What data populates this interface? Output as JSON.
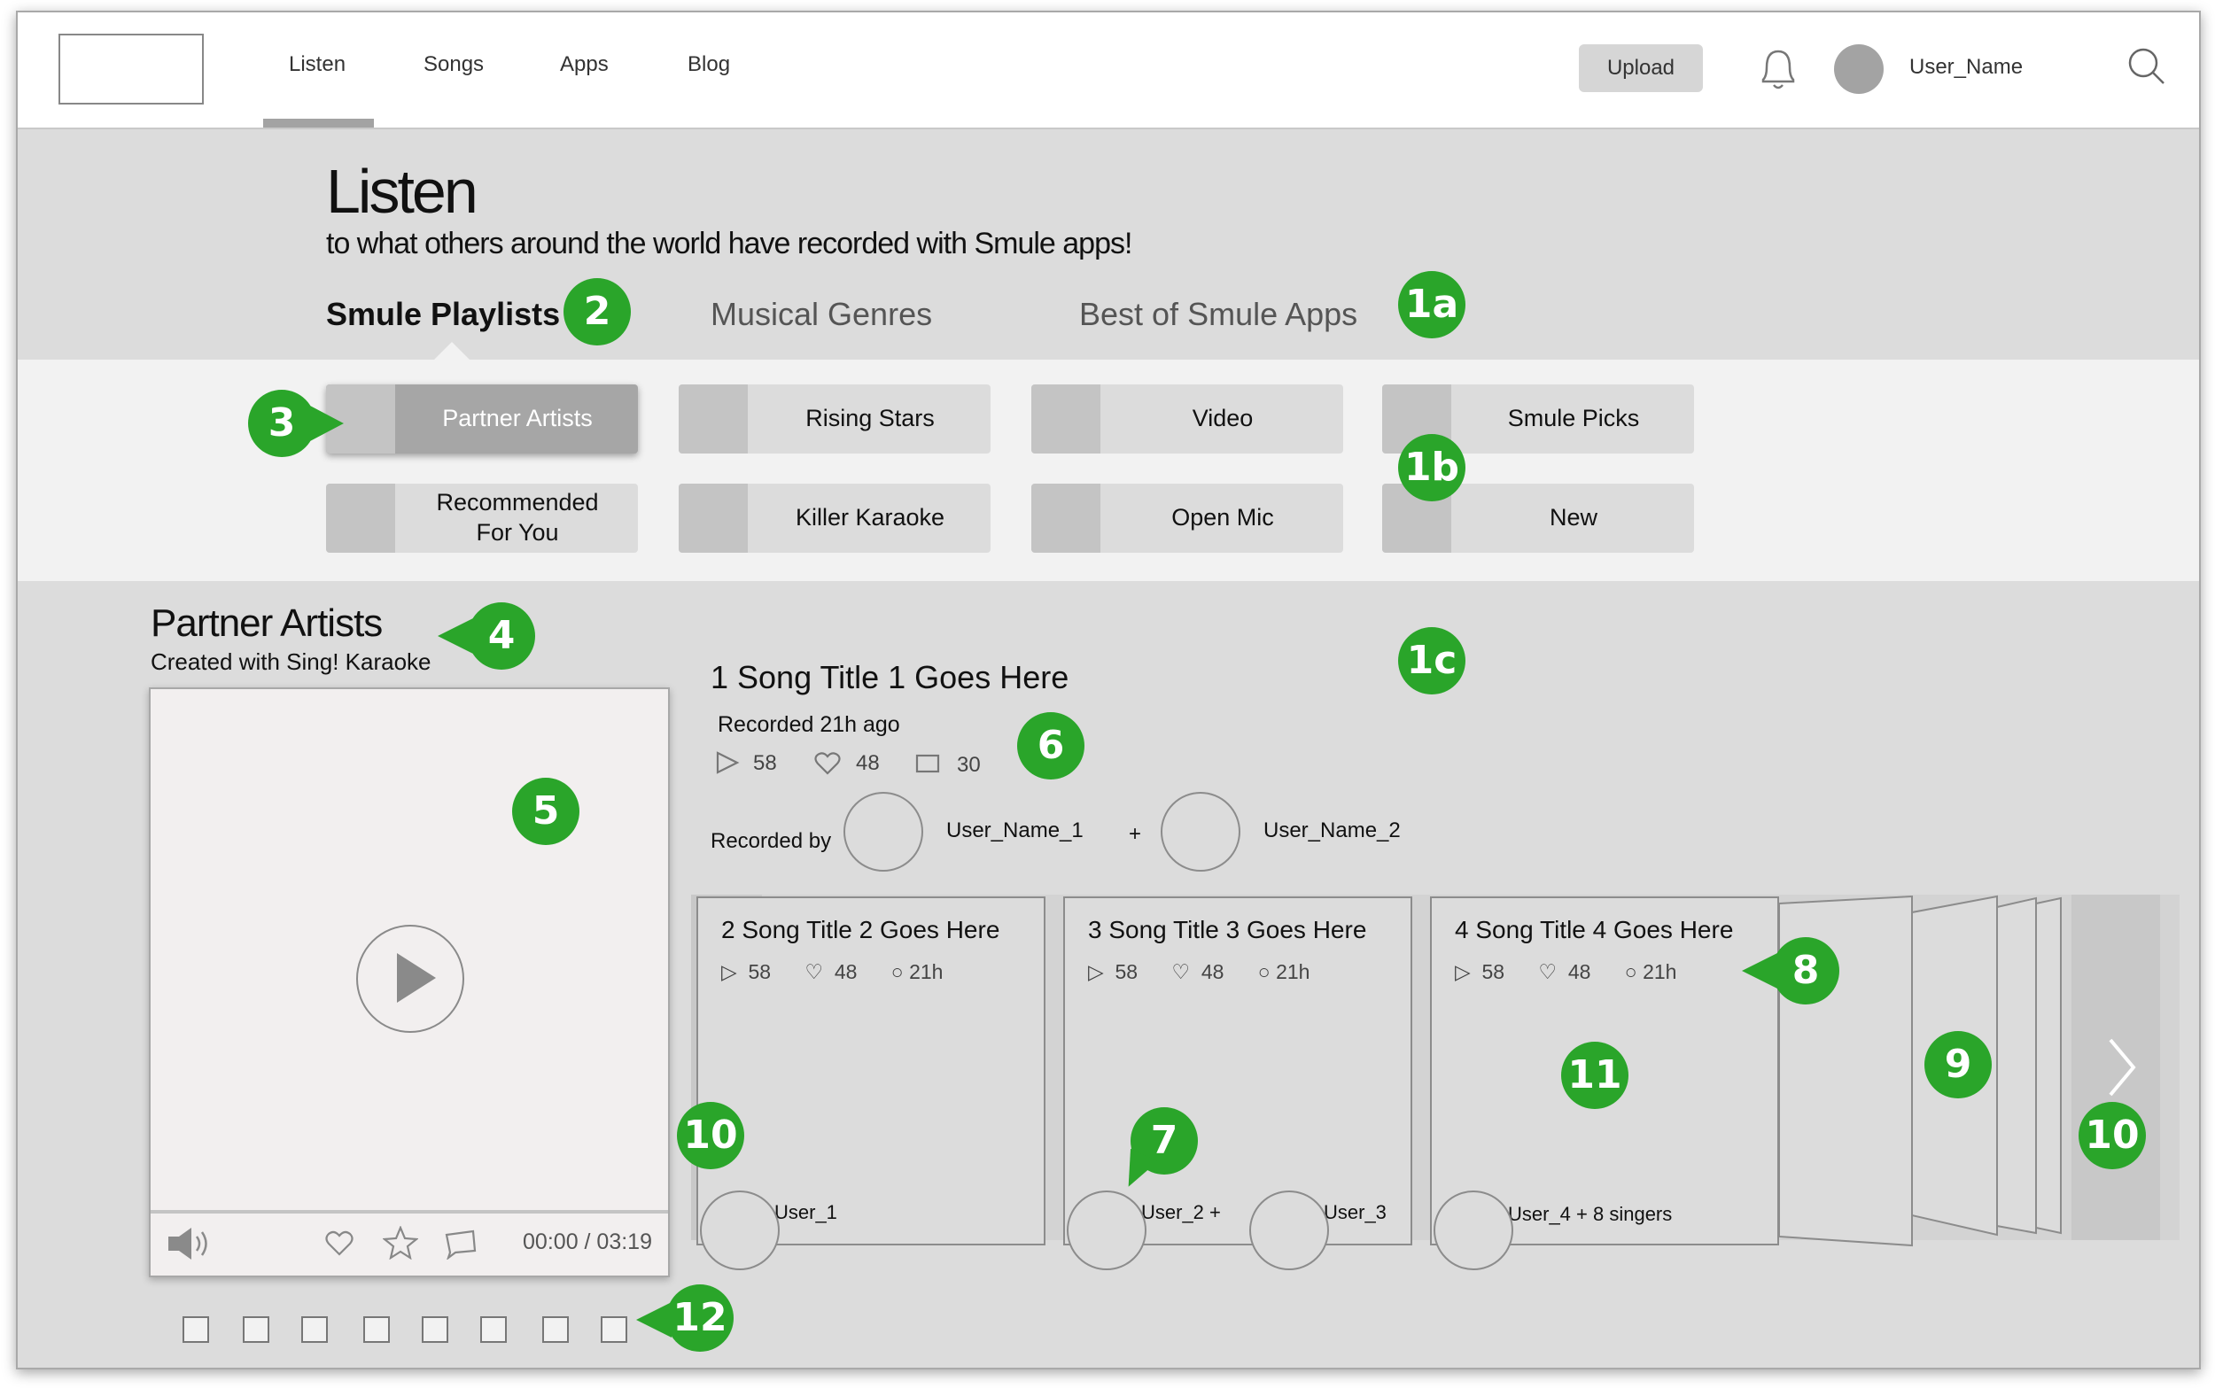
{
  "nav": {
    "items": [
      "Listen",
      "Songs",
      "Apps",
      "Blog"
    ],
    "upload_label": "Upload",
    "username": "User_Name"
  },
  "hero": {
    "title": "Listen",
    "subtitle": "to what others around the world have recorded with Smule apps!"
  },
  "tabs": [
    "Smule Playlists",
    "Musical Genres",
    "Best of Smule Apps"
  ],
  "categories": [
    "Partner Artists",
    "Rising Stars",
    "Video",
    "Smule Picks",
    "Recommended For You",
    "Killer Karaoke",
    "Open Mic",
    "New"
  ],
  "section": {
    "title": "Partner Artists",
    "subtitle": "Created with Sing! Karaoke"
  },
  "player": {
    "time": "00:00 / 03:19"
  },
  "featured": {
    "title": "1 Song Title 1 Goes Here",
    "recorded": "Recorded 21h ago",
    "plays": "58",
    "likes": "48",
    "comments": "30",
    "recorded_by_label": "Recorded by",
    "user1": "User_Name_1",
    "plus": "+",
    "user2": "User_Name_2"
  },
  "cards": [
    {
      "title": "2 Song Title 2 Goes Here",
      "plays": "58",
      "likes": "48",
      "age": "21h",
      "users": "User_1"
    },
    {
      "title": "3 Song Title 3 Goes Here",
      "plays": "58",
      "likes": "48",
      "age": "21h",
      "users": "User_2 +",
      "users2": "User_3"
    },
    {
      "title": "4 Song Title 4 Goes Here",
      "plays": "58",
      "likes": "48",
      "age": "21h",
      "users": "User_4 + 8 singers"
    }
  ],
  "markers": [
    "1a",
    "1b",
    "1c",
    "2",
    "3",
    "4",
    "5",
    "6",
    "7",
    "8",
    "9",
    "10",
    "10",
    "11",
    "12"
  ],
  "colors": {
    "marker": "#2aa52a",
    "background": "#dcdcdc"
  }
}
